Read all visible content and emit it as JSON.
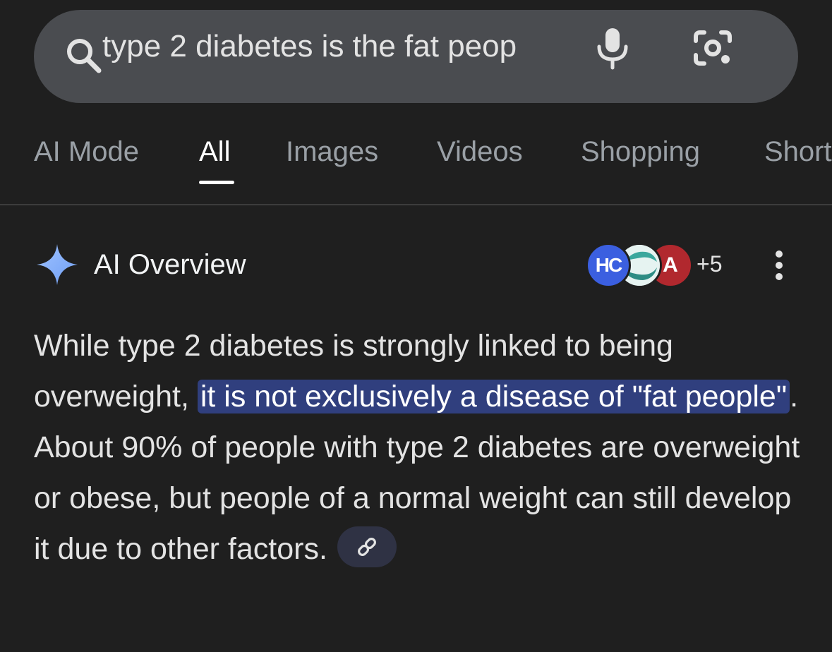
{
  "search": {
    "query": "type 2 diabetes is the fat peop"
  },
  "tabs": [
    {
      "label": "AI Mode"
    },
    {
      "label": "All",
      "active": true
    },
    {
      "label": "Images"
    },
    {
      "label": "Videos"
    },
    {
      "label": "Shopping"
    },
    {
      "label": "Short"
    }
  ],
  "ai_overview": {
    "title": "AI Overview",
    "sources": {
      "badge_1": "HC",
      "badge_3": "A",
      "more": "+5"
    },
    "text_before": "While type 2 diabetes is strongly linked to being overweight, ",
    "highlight": "it is not exclusively a disease of \"fat people\"",
    "text_after": ". About 90% of people with type 2 diabetes are overweight or obese, but people of a normal weight can still develop it due to other factors."
  },
  "colors": {
    "background": "#1f1f1f",
    "search_bar": "#4a4c50",
    "highlight": "#303f7e",
    "sparkle": "#8ab4f8",
    "link_chip": "#2f3244"
  },
  "icons": [
    "search-icon",
    "mic-icon",
    "lens-icon",
    "sparkle-icon",
    "more-vert-icon",
    "link-icon"
  ]
}
